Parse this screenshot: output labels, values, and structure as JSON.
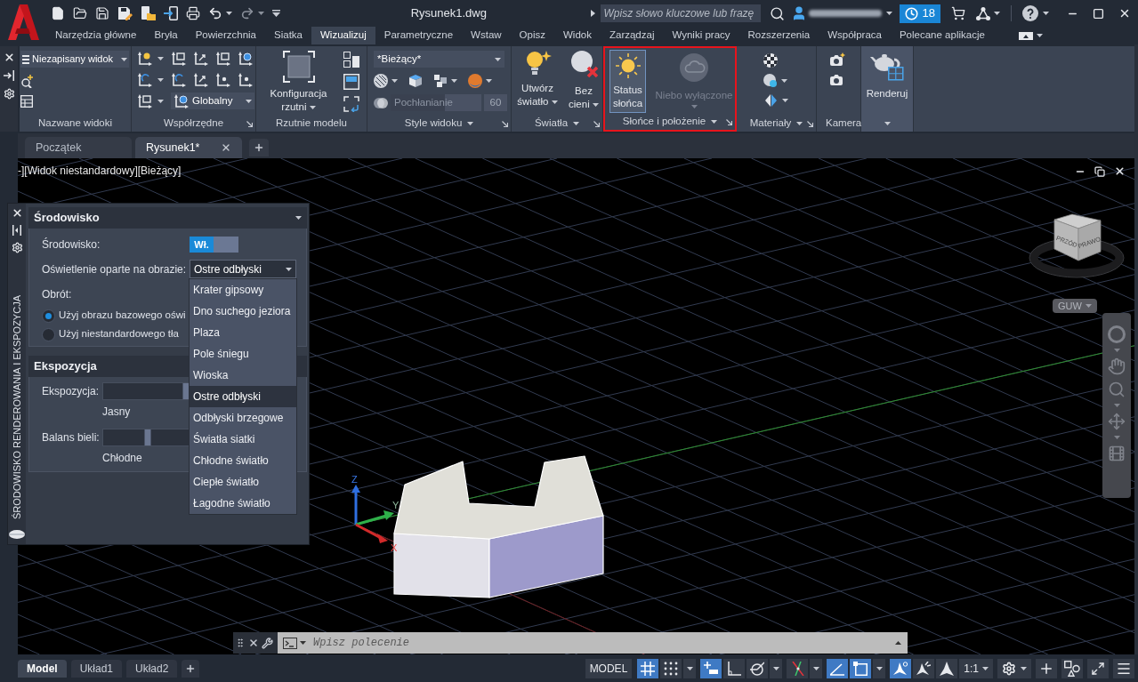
{
  "title_bar": {
    "title": "Rysunek1.dwg",
    "search": {
      "placeholder": "Wpisz słowo kluczowe lub frazę"
    },
    "notification_count": "18"
  },
  "ribbon_tabs": [
    {
      "label": "Narzędzia główne",
      "selected": false
    },
    {
      "label": "Bryła",
      "selected": false
    },
    {
      "label": "Powierzchnia",
      "selected": false
    },
    {
      "label": "Siatka",
      "selected": false
    },
    {
      "label": "Wizualizuj",
      "selected": true
    },
    {
      "label": "Parametryczne",
      "selected": false
    },
    {
      "label": "Wstaw",
      "selected": false
    },
    {
      "label": "Opisz",
      "selected": false
    },
    {
      "label": "Widok",
      "selected": false
    },
    {
      "label": "Zarządzaj",
      "selected": false
    },
    {
      "label": "Wyniki pracy",
      "selected": false
    },
    {
      "label": "Rozszerzenia",
      "selected": false
    },
    {
      "label": "Współpraca",
      "selected": false
    },
    {
      "label": "Polecane aplikacje",
      "selected": false
    }
  ],
  "ribbon_panels": [
    {
      "kind": "named_views",
      "title": "Nazwane widoki",
      "view": "Niezapisany widok"
    },
    {
      "kind": "coordinates",
      "title": "Współrzędne",
      "ucs": "Globalny"
    },
    {
      "kind": "viewports",
      "title": "Rzutnie modelu",
      "button": "Konfiguracja rzutni"
    },
    {
      "kind": "visual_styles",
      "title": "Style widoku",
      "style": "*Bieżący*",
      "opacity": {
        "label": "Pochłanianie",
        "value": "60",
        "level": 0.6
      }
    },
    {
      "kind": "lights",
      "title": "Światła",
      "buttons": [
        {
          "kind": "bulb",
          "label": "Utwórz światło"
        },
        {
          "kind": "no_shadow",
          "label": "Bez cieni"
        }
      ]
    },
    {
      "kind": "sun",
      "title": "Słońce i położenie",
      "highlighted": true,
      "buttons": [
        {
          "kind": "sun",
          "label": "Status słońca",
          "active": true,
          "disabled": false
        },
        {
          "kind": "sky",
          "label": "Niebo wyłączone",
          "active": false,
          "disabled": true
        }
      ]
    },
    {
      "kind": "materials",
      "title": "Materiały"
    },
    {
      "kind": "camera",
      "title": "Kamera"
    },
    {
      "kind": "render",
      "button": "Renderuj"
    }
  ],
  "document_tabs": [
    {
      "label": "Początek",
      "selected": false
    },
    {
      "label": "Rysunek1*",
      "selected": true
    }
  ],
  "viewport": {
    "label": "-][Widok niestandardowy][Bieżący]",
    "cube_faces": [
      "PRZÓD",
      "PRAWO"
    ],
    "ucs_menu": "GUW",
    "axis_labels": [
      "Z",
      "Y",
      "X"
    ]
  },
  "palette": {
    "title": "ŚRODOWISKO RENDEROWANIA I EKSPOZYCJA",
    "environment": {
      "title": "Środowisko",
      "environment_label": "Środowisko:",
      "toggle": {
        "label": "Wł.",
        "on": true
      },
      "lighting_label": "Oświetlenie oparte na obrazie:",
      "lighting_value": "Ostre odbłyski",
      "lighting_options": [
        {
          "label": "Krater gipsowy",
          "selected": false
        },
        {
          "label": "Dno suchego jeziora",
          "selected": false
        },
        {
          "label": "Plaza",
          "selected": false
        },
        {
          "label": "Pole śniegu",
          "selected": false
        },
        {
          "label": "Wioska",
          "selected": false
        },
        {
          "label": "Ostre odbłyski",
          "selected": true
        },
        {
          "label": "Odbłyski brzegowe",
          "selected": false
        },
        {
          "label": "Światła siatki",
          "selected": false
        },
        {
          "label": "Chłodne światło",
          "selected": false
        },
        {
          "label": "Ciepłe światło",
          "selected": false
        },
        {
          "label": "Łagodne światło",
          "selected": false
        }
      ],
      "rotation_label": "Obrót:",
      "background_options": [
        {
          "label": "Użyj obrazu bazowego oświ",
          "selected": true
        },
        {
          "label": "Użyj niestandardowego tła",
          "selected": false
        }
      ]
    },
    "exposure": {
      "title": "Ekspozycja",
      "sliders": [
        {
          "label": "Ekspozycja:",
          "caption": "Jasny",
          "level": 0.43
        },
        {
          "label": "Balans bieli:",
          "caption": "Chłodne",
          "level": 0.23
        }
      ]
    }
  },
  "command_line": {
    "placeholder": "Wpisz polecenie"
  },
  "layout_tabs": [
    {
      "label": "Model",
      "selected": true
    },
    {
      "label": "Układ1",
      "selected": false
    },
    {
      "label": "Układ2",
      "selected": false
    }
  ],
  "status_bar": {
    "space": "MODEL",
    "tools": [
      {
        "kind": "grid",
        "on": true
      },
      {
        "kind": "snap",
        "on": false
      },
      {
        "kind": "infer",
        "on": true
      },
      {
        "kind": "ortho",
        "on": false
      },
      {
        "kind": "polar",
        "on": false
      },
      {
        "kind": "osnap_track",
        "on": false
      },
      {
        "kind": "dynamic_ucs",
        "on": true
      },
      {
        "kind": "selection_cycling",
        "on": true
      },
      {
        "kind": "annotation_visibility",
        "on": true
      },
      {
        "kind": "autoscale",
        "on": false
      },
      {
        "kind": "annotation_scale",
        "on": false
      }
    ],
    "scale": "1:1"
  }
}
